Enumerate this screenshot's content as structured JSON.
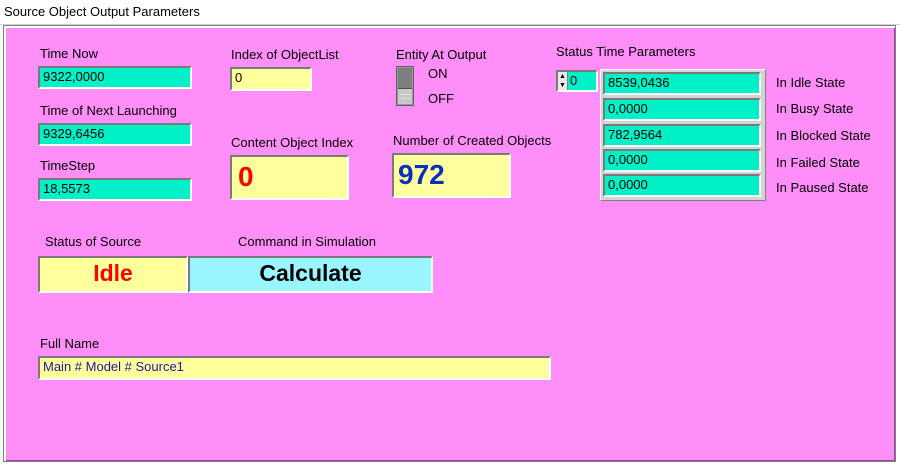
{
  "window": {
    "title": "Source Object Output Parameters"
  },
  "time_now": {
    "label": "Time Now",
    "value": "9322,0000"
  },
  "next_launching": {
    "label": "Time of Next Launching",
    "value": "9329,6456"
  },
  "timestep": {
    "label": "TimeStep",
    "value": "18,5573"
  },
  "index_objectlist": {
    "label": "Index of ObjectList",
    "value": "0"
  },
  "content_object_index": {
    "label": "Content Object Index",
    "value": "0"
  },
  "entity_at_output": {
    "label": "Entity At Output",
    "on_label": "ON",
    "off_label": "OFF",
    "state": "OFF"
  },
  "created_objects": {
    "label": "Number of Created Objects",
    "value": "972"
  },
  "status_time": {
    "label": "Status Time Parameters",
    "spinner_value": "0",
    "rows": [
      {
        "label": "In Idle State",
        "value": "8539,0436"
      },
      {
        "label": "In Busy State",
        "value": "0,0000"
      },
      {
        "label": "In Blocked State",
        "value": "782,9564"
      },
      {
        "label": "In Failed State",
        "value": "0,0000"
      },
      {
        "label": "In Paused State",
        "value": "0,0000"
      }
    ]
  },
  "status_of_source": {
    "label": "Status of Source",
    "value": "Idle"
  },
  "command": {
    "label": "Command in Simulation",
    "value": "Calculate"
  },
  "full_name": {
    "label": "Full Name",
    "value": "Main # Model # Source1"
  },
  "colors": {
    "panel_bg": "#ff8ef8",
    "teal_field": "#00f0c8",
    "yellow_field": "#ffff9c",
    "cyan_field": "#99f5ff",
    "idle_text": "#ff0000",
    "count_text": "#0a2fbe",
    "full_name_text": "#1a1aa0"
  }
}
